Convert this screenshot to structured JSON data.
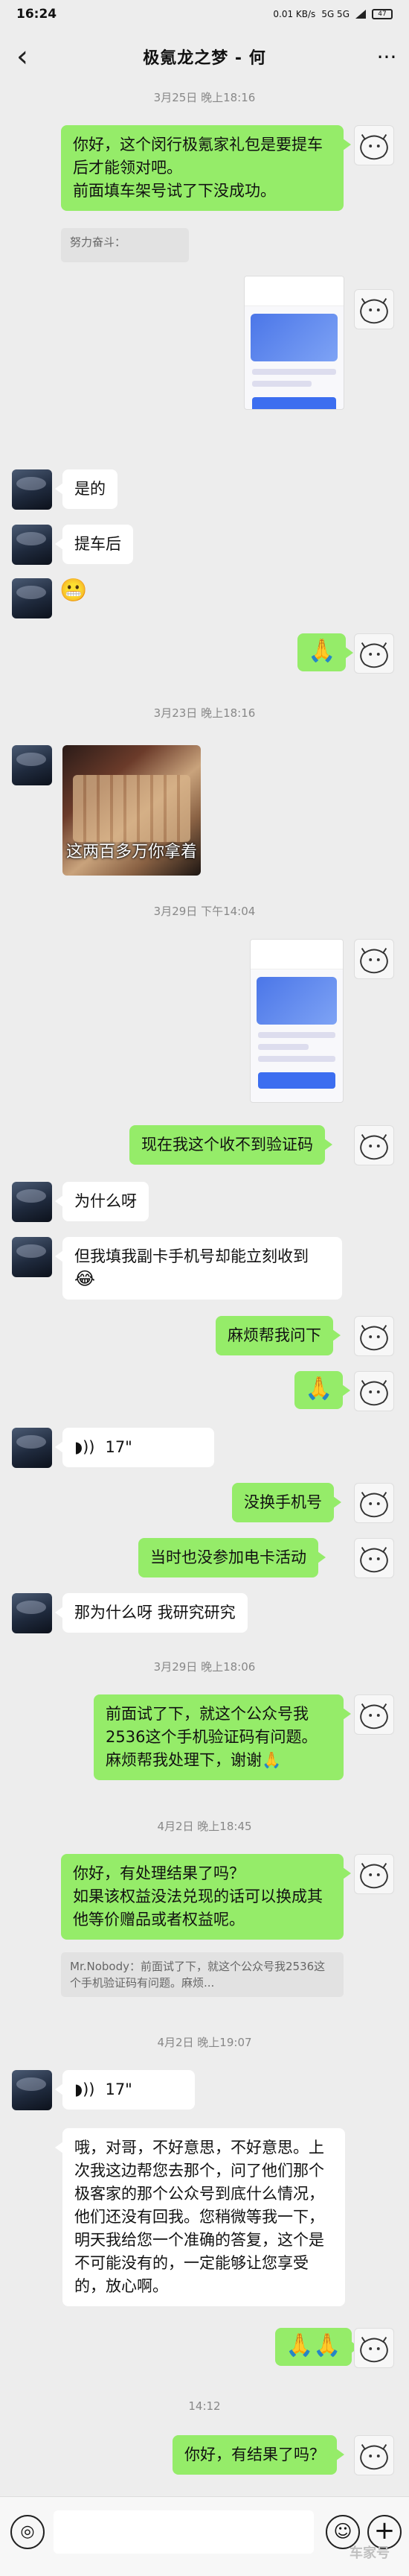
{
  "status": {
    "time": "16:24",
    "net": "0.01 KB/s",
    "signal": "5G 5G",
    "battery": "47"
  },
  "nav": {
    "back": "‹",
    "title": "极氪龙之梦 - 何",
    "more": "···"
  },
  "timestamps": [
    "3月25日 晚上18:16",
    "3月23日 晚上18:16",
    "3月29日 下午14:04",
    "3月29日 晚上18:06",
    "4月2日 晚上18:45",
    "4月2日 晚上19:07",
    "14:12"
  ],
  "messages": {
    "m1": "你好，这个闵行极氪家礼包是要提车后才能领对吧。\n前面填车架号试了下没成功。",
    "m1_quote": "努力奋斗：",
    "m2": "是的",
    "m3": "提车后",
    "m4_emoji": "😬",
    "m5_emoji": "🙏",
    "photo_caption": "这两百多万你拿着",
    "m7": "现在我这个收不到验证码",
    "m8": "为什么呀",
    "m9": "但我填我副卡手机号却能立刻收到",
    "m9_emoji": "😂",
    "m10": "麻烦帮我问下",
    "m11_emoji": "🙏",
    "m12_voice": "17\"",
    "m13": "没换手机号",
    "m14": "当时也没参加电卡活动",
    "m15": "那为什么呀 我研究研究",
    "m16": "前面试了下，就这个公众号我2536这个手机验证码有问题。麻烦帮我处理下，谢谢🙏",
    "m17": "你好，有处理结果了吗？\n如果该权益没法兑现的话可以换成其他等价赠品或者权益呢。",
    "m17_quote": "Mr.Nobody：前面试了下，就这个公众号我2536这个手机验证码有问题。麻烦...",
    "m18_voice": "17\"",
    "m19": "哦，对哥，不好意思，不好意思。上次我这边帮您去那个，问了他们那个极客家的那个公众号到底什么情况，他们还没有回我。您稍微等我一下，明天我给您一个准确的答复，这个是不可能没有的，一定能够让您享受的，放心啊。",
    "m20_emoji": "🙏🙏",
    "m21": "你好，有结果了吗？"
  },
  "input": {
    "voice_icon": "◎",
    "emoji_icon": "☺",
    "plus_icon": "+"
  },
  "watermark": "车家号"
}
